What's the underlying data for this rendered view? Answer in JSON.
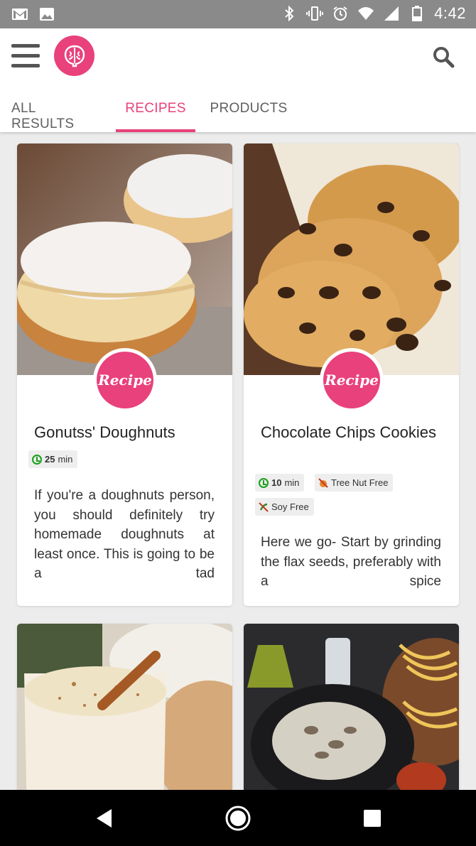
{
  "status_bar": {
    "time": "4:42",
    "left_icons": [
      "gmail-icon",
      "image-icon"
    ],
    "right_icons": [
      "bluetooth-icon",
      "vibrate-icon",
      "alarm-icon",
      "wifi-icon",
      "signal-icon",
      "battery-icon"
    ]
  },
  "app_bar": {
    "menu_icon": "hamburger-menu-icon",
    "logo_icon": "brain-logo-icon",
    "search_icon": "search-icon"
  },
  "tabs": [
    {
      "label": "ALL RESULTS",
      "active": false
    },
    {
      "label": "RECIPES",
      "active": true
    },
    {
      "label": "PRODUCTS",
      "active": false
    }
  ],
  "colors": {
    "accent": "#e8417b",
    "status_bar": "#8a8a8a",
    "background": "#ececec"
  },
  "recipes": [
    {
      "badge": "Recipe",
      "title": "Gonutss' Doughnuts",
      "time_value": "25",
      "time_unit": "min",
      "tags": [],
      "description": "If you're a doughnuts person, you should definitely try homemade doughnuts at least once. This is going to be a tad"
    },
    {
      "badge": "Recipe",
      "title": "Chocolate Chips Cookies",
      "time_value": "10",
      "time_unit": "min",
      "tags": [
        "Tree Nut Free",
        "Soy Free"
      ],
      "description": "Here we go- Start by grinding the flax seeds, preferably with a spice"
    }
  ],
  "nav_bar": {
    "icons": [
      "back-icon",
      "home-icon",
      "recents-icon"
    ]
  }
}
